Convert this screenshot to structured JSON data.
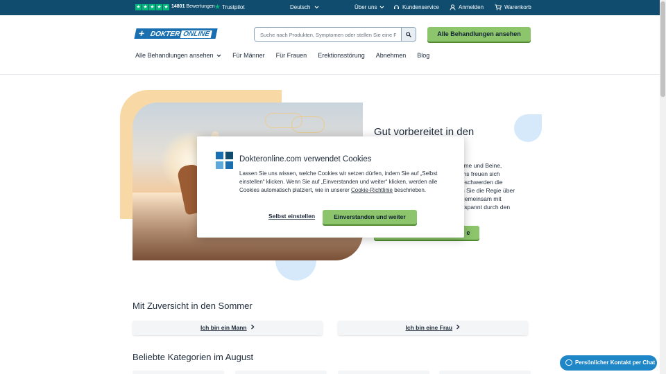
{
  "topbar": {
    "reviews_count": "14801",
    "reviews_label": "Bewertungen",
    "trustpilot": "Trustpilot",
    "language": "Deutsch",
    "about": "Über uns",
    "service": "Kundenservice",
    "login": "Anmelden",
    "cart": "Warenkorb"
  },
  "header": {
    "logo_left": "DOKTER",
    "logo_right": "ONLINE",
    "search_placeholder": "Suche nach Produkten, Symptomen oder stellen Sie eine Frage",
    "cta": "Alle Behandlungen ansehen"
  },
  "nav": {
    "items": [
      "Alle Behandlungen ansehen",
      "Für Männer",
      "Für Frauen",
      "Erektionsstörung",
      "Abnehmen",
      "Blog"
    ]
  },
  "hero": {
    "title_line1": "Gut vorbereitet in den",
    "text_lines": [
      "te Arme und Beine,",
      "on uns freuen sich",
      "eschwerden die",
      "n Sie die Regie über",
      "gemeinsam mit",
      "z entspannt durch den"
    ],
    "button": "e"
  },
  "sections": {
    "summer_title": "Mit Zuversicht in den Sommer",
    "man": "Ich bin ein Mann",
    "woman": "Ich bin eine Frau",
    "categories_title": "Beliebte Kategorien im August"
  },
  "cookie": {
    "title": "Dokteronline.com verwendet Cookies",
    "text_before": "Lassen Sie uns wissen, welche Cookies wir setzen dürfen, indem Sie auf „Selbst einstellen“ klicken. Wenn Sie auf „Einverstanden und weiter“ klicken, werden alle Cookies automatisch platziert, wie in unserer ",
    "link": "Cookie-Richtlinie",
    "text_after": " beschrieben.",
    "btn_custom": "Selbst einstellen",
    "btn_accept": "Einverstanden und weiter"
  },
  "chat": {
    "label": "Persönlicher Kontakt per Chat"
  },
  "colors": {
    "topbar": "#0f4c6e",
    "accent_green": "#8cc56b",
    "brand_blue": "#1a6fb0",
    "trustpilot": "#00b67a"
  }
}
